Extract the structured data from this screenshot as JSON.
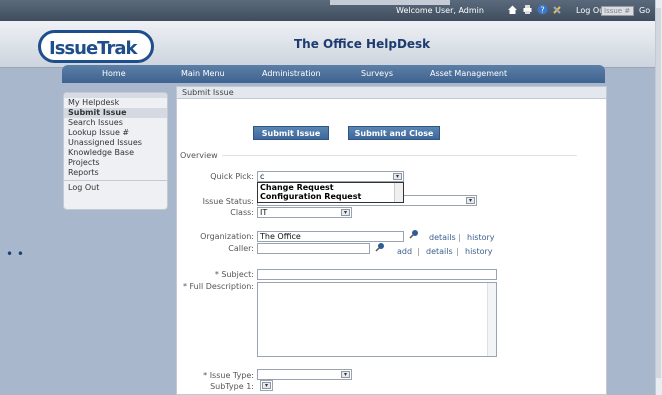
{
  "topbar": {
    "welcome": "Welcome User, Admin",
    "logout": "Log Out",
    "issue_placeholder": "Issue #",
    "go": "Go",
    "icons": [
      "home-icon",
      "print-icon",
      "help-icon",
      "tools-icon"
    ]
  },
  "header": {
    "logo_text": "IssueTrak",
    "title": "The Office HelpDesk"
  },
  "nav": [
    "Home",
    "Main Menu",
    "Administration",
    "Surveys",
    "Asset Management"
  ],
  "sidebar": {
    "group1": [
      "My Helpdesk",
      "Submit Issue",
      "Search Issues",
      "Lookup Issue #",
      "Unassigned Issues",
      "Knowledge Base",
      "Projects",
      "Reports"
    ],
    "group2": [
      "Log Out"
    ],
    "active": "Submit Issue"
  },
  "main": {
    "heading": "Submit Issue",
    "buttons": {
      "submit": "Submit Issue",
      "submit_close": "Submit and Close"
    },
    "section": "Overview",
    "labels": {
      "quick_pick": "Quick Pick:",
      "issue_status": "Issue Status:",
      "class": "Class:",
      "organization": "Organization:",
      "caller": "Caller:",
      "subject": "* Subject:",
      "full_description": "* Full Description:",
      "issue_type": "* Issue Type:",
      "subtype": "SubType 1:"
    },
    "values": {
      "quick_pick": "c",
      "class": "IT",
      "organization": "The Office",
      "caller": "",
      "subject": ""
    },
    "quick_pick_options": [
      "Change Request",
      "Configuration Request"
    ],
    "links": {
      "details": "details",
      "history": "history",
      "add": "add"
    },
    "separator": "|"
  },
  "colors": {
    "brand": "#1f4e8c",
    "nav": "#4a6f9c",
    "button": "#4a76a8",
    "background": "#a9b7cd"
  }
}
